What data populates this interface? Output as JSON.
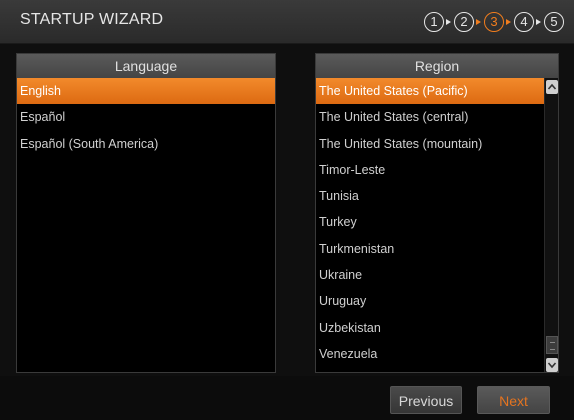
{
  "window": {
    "title": "STARTUP WIZARD"
  },
  "steps": [
    {
      "label": "1",
      "active": false
    },
    {
      "label": "2",
      "active": false
    },
    {
      "label": "3",
      "active": true
    },
    {
      "label": "4",
      "active": false
    },
    {
      "label": "5",
      "active": false
    }
  ],
  "language_panel": {
    "header": "Language",
    "items": [
      "English",
      "Español",
      "Español (South America)"
    ],
    "selected_index": 0
  },
  "region_panel": {
    "header": "Region",
    "items": [
      "The United States (Pacific)",
      "The United States (central)",
      "The United States (mountain)",
      "Timor-Leste",
      "Tunisia",
      "Turkey",
      "Turkmenistan",
      "Ukraine",
      "Uruguay",
      "Uzbekistan",
      "Venezuela"
    ],
    "selected_index": 0
  },
  "buttons": {
    "previous": "Previous",
    "next": "Next"
  },
  "colors": {
    "accent": "#f07d1e",
    "background": "#000000"
  }
}
